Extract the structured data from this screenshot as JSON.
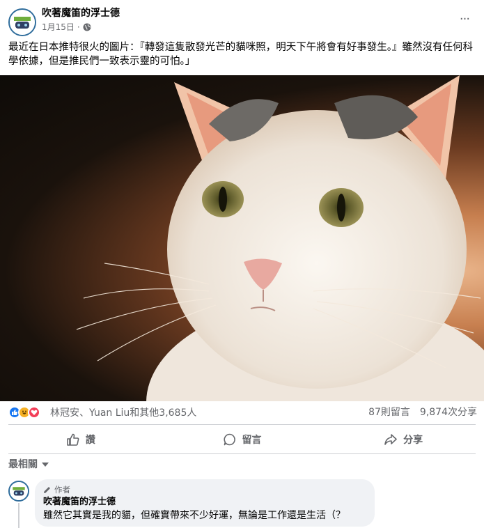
{
  "post": {
    "author": "吹著魔笛的浮士德",
    "date": "1月15日",
    "date_separator": "·",
    "visibility_icon": "globe-icon",
    "more_label": "···",
    "text": "最近在日本推特很火的圖片：『轉發這隻散發光芒的貓咪照，明天下午將會有好事發生。』雖然沒有任何科學依據，但是推民們一致表示靈的可怕。」"
  },
  "reactions": {
    "icons": [
      "like-icon",
      "haha-icon",
      "love-icon"
    ],
    "summary": "林冠安、Yuan Liu和其他3,685人",
    "comments": "87則留言",
    "shares": "9,874次分享"
  },
  "actions": {
    "like": "讚",
    "comment": "留言",
    "share": "分享"
  },
  "sort": {
    "label": "最相關"
  },
  "comment": {
    "badge": "作者",
    "author": "吹著魔笛的浮士德",
    "text": "雖然它其實是我的貓，但確實帶來不少好運，無論是工作還是生活（？"
  },
  "colors": {
    "brand_blue": "#1877f2",
    "text_secondary": "#65676b",
    "bubble_bg": "#f0f2f5"
  }
}
